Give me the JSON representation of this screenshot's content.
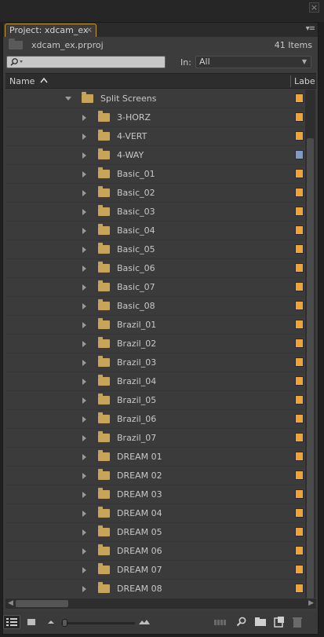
{
  "panel": {
    "tab_label": "Project: xdcam_ex",
    "tab_close": "×",
    "menu_glyph": "▾≡",
    "window_close": "×"
  },
  "project": {
    "file_name": "xdcam_ex.prproj",
    "item_count": "41 Items"
  },
  "search": {
    "placeholder": "",
    "in_label": "In:",
    "in_value": "All"
  },
  "columns": {
    "name": "Name",
    "label": "Labe"
  },
  "colors": {
    "orange_label": "#f2a23a",
    "blue_label": "#7e9ac7",
    "folder": "#c8a35a",
    "tab_accent": "#c79a35"
  },
  "rows": [
    {
      "name": "Split Screens",
      "expanded": true,
      "level": 0,
      "label": "orange"
    },
    {
      "name": "3-HORZ",
      "level": 1,
      "label": "orange"
    },
    {
      "name": "4-VERT",
      "level": 1,
      "label": "orange"
    },
    {
      "name": "4-WAY",
      "level": 1,
      "label": "blue"
    },
    {
      "name": "Basic_01",
      "level": 1,
      "label": "orange"
    },
    {
      "name": "Basic_02",
      "level": 1,
      "label": "orange"
    },
    {
      "name": "Basic_03",
      "level": 1,
      "label": "orange"
    },
    {
      "name": "Basic_04",
      "level": 1,
      "label": "orange"
    },
    {
      "name": "Basic_05",
      "level": 1,
      "label": "orange"
    },
    {
      "name": "Basic_06",
      "level": 1,
      "label": "orange"
    },
    {
      "name": "Basic_07",
      "level": 1,
      "label": "orange"
    },
    {
      "name": "Basic_08",
      "level": 1,
      "label": "orange"
    },
    {
      "name": "Brazil_01",
      "level": 1,
      "label": "orange"
    },
    {
      "name": "Brazil_02",
      "level": 1,
      "label": "orange"
    },
    {
      "name": "Brazil_03",
      "level": 1,
      "label": "orange"
    },
    {
      "name": "Brazil_04",
      "level": 1,
      "label": "orange"
    },
    {
      "name": "Brazil_05",
      "level": 1,
      "label": "orange"
    },
    {
      "name": "Brazil_06",
      "level": 1,
      "label": "orange"
    },
    {
      "name": "Brazil_07",
      "level": 1,
      "label": "orange"
    },
    {
      "name": "DREAM 01",
      "level": 1,
      "label": "orange"
    },
    {
      "name": "DREAM 02",
      "level": 1,
      "label": "orange"
    },
    {
      "name": "DREAM 03",
      "level": 1,
      "label": "orange"
    },
    {
      "name": "DREAM 04",
      "level": 1,
      "label": "orange"
    },
    {
      "name": "DREAM 05",
      "level": 1,
      "label": "orange"
    },
    {
      "name": "DREAM 06",
      "level": 1,
      "label": "orange"
    },
    {
      "name": "DREAM 07",
      "level": 1,
      "label": "orange"
    },
    {
      "name": "DREAM 08",
      "level": 1,
      "label": "orange"
    }
  ],
  "icons": {
    "search": "magnifier-icon",
    "sort": "sort-ascending-icon",
    "list_view": "list-view-icon",
    "icon_view": "icon-view-icon",
    "find": "find-icon",
    "new_bin": "new-bin-icon",
    "new_item": "new-item-icon",
    "clear": "trash-icon"
  }
}
